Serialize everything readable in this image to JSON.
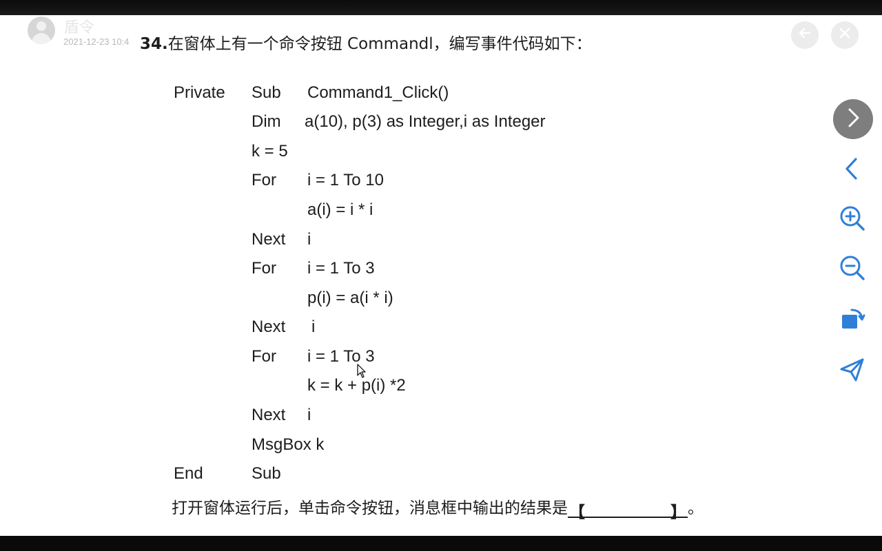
{
  "header": {
    "username": "盾令",
    "timestamp": "2021-12-23 10:4"
  },
  "document": {
    "question_number": "34.",
    "question_title": "在窗体上有一个命令按钮 Commandl，编写事件代码如下：",
    "code": {
      "l1_a": "Private",
      "l1_b": "Sub",
      "l1_c": "Command1_Click()",
      "l2_a": "Dim",
      "l2_b": "a(10), p(3) as Integer,i as Integer",
      "l3_a": "k = 5",
      "l4_a": "For",
      "l4_b": "i = 1 To 10",
      "l5_a": "a(i) = i * i",
      "l6_a": "Next",
      "l6_b": "i",
      "l7_a": "For",
      "l7_b": "i = 1 To 3",
      "l8_a": "p(i) = a(i * i)",
      "l9_a": "Next",
      "l9_b": "i",
      "l10_a": "For",
      "l10_b": "i = 1 To 3",
      "l11_a": "k = k + p(i) *2",
      "l12_a": "Next",
      "l12_b": "i",
      "l13_a": "MsgBox k",
      "l14_a": "End",
      "l14_b": "Sub"
    },
    "question_prompt": "打开窗体运行后，单击命令按钮，消息框中输出的结果是",
    "blank_left": "【",
    "blank_right": "】",
    "question_end": "。"
  },
  "icons": {
    "back": "arrow-left-icon",
    "close": "close-icon",
    "next": "chevron-right-icon",
    "previous": "chevron-left-icon",
    "zoom_in": "zoom-in-icon",
    "zoom_out": "zoom-out-icon",
    "rotate": "rotate-icon",
    "share": "send-icon"
  },
  "colors": {
    "accent": "#2f7fd9",
    "next_button": "#7e7e7e",
    "text": "#1d1d1d"
  }
}
